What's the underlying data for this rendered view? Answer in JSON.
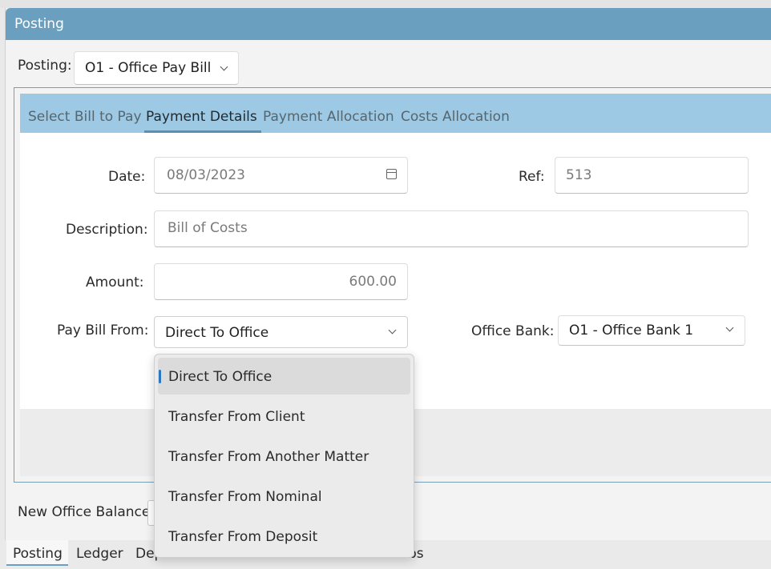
{
  "panel": {
    "title": "Posting"
  },
  "posting": {
    "label": "Posting:",
    "value": "O1 - Office Pay Bill"
  },
  "tabs": [
    {
      "label": "Select Bill to Pay"
    },
    {
      "label": "Payment Details"
    },
    {
      "label": "Payment Allocation"
    },
    {
      "label": "Costs Allocation"
    }
  ],
  "form": {
    "date_label": "Date:",
    "date_value": "08/03/2023",
    "ref_label": "Ref:",
    "ref_value": "513",
    "description_label": "Description:",
    "description_value": "Bill of Costs",
    "amount_label": "Amount:",
    "amount_value": "600.00",
    "pay_from_label": "Pay Bill From:",
    "pay_from_value": "Direct To Office",
    "office_bank_label": "Office Bank:",
    "office_bank_value": "O1 - Office Bank 1"
  },
  "dropdown": {
    "options": [
      {
        "label": "Direct To Office"
      },
      {
        "label": "Transfer From Client"
      },
      {
        "label": "Transfer From Another Matter"
      },
      {
        "label": "Transfer From Nominal"
      },
      {
        "label": "Transfer From Deposit"
      }
    ],
    "selected_index": 0
  },
  "balance": {
    "label": "New Office Balance:"
  },
  "bottom_tabs": [
    {
      "label": "Posting"
    },
    {
      "label": "Ledger"
    },
    {
      "label": "Dep"
    },
    {
      "label": "bs"
    }
  ],
  "colors": {
    "header": "#6a9fbf",
    "tabbar": "#9dc9e4",
    "selection_indicator": "#2a78c2"
  },
  "icons": {
    "calendar": "calendar-icon",
    "chevron": "chevron-down-icon"
  }
}
